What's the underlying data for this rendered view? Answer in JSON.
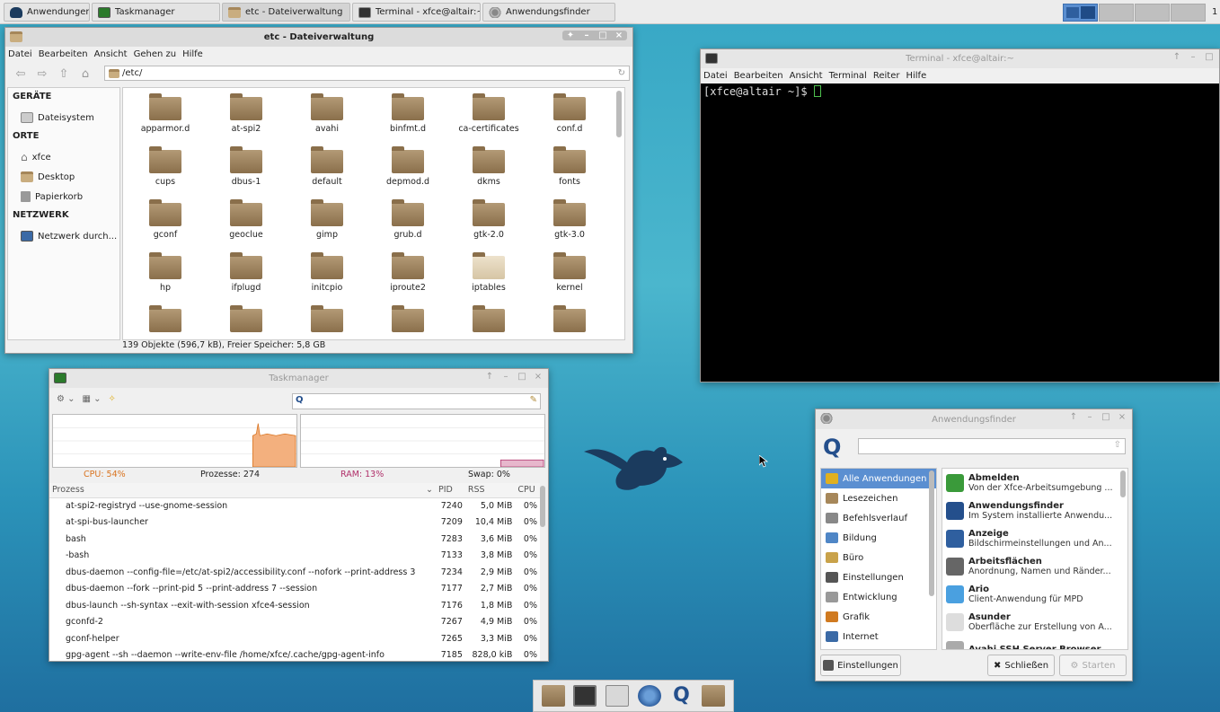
{
  "top_panel": {
    "tasks": [
      {
        "label": "Anwendungen",
        "icon": "xfce-mouse-icon"
      },
      {
        "label": "Taskmanager",
        "icon": "task-manager-icon"
      },
      {
        "label": "etc - Dateiverwaltung",
        "icon": "folder-icon"
      },
      {
        "label": "Terminal - xfce@altair:~",
        "icon": "terminal-icon"
      },
      {
        "label": "Anwendungsfinder",
        "icon": "app-finder-icon"
      }
    ],
    "clock": "1"
  },
  "file_manager": {
    "title": "etc - Dateiverwaltung",
    "menu": [
      "Datei",
      "Bearbeiten",
      "Ansicht",
      "Gehen zu",
      "Hilfe"
    ],
    "path": "/etc/",
    "sidebar": {
      "geraete_header": "GERÄTE",
      "dateisystem": "Dateisystem",
      "orte_header": "ORTE",
      "xfce": "xfce",
      "desktop": "Desktop",
      "papierkorb": "Papierkorb",
      "netzwerk_header": "NETZWERK",
      "netzwerk_item": "Netzwerk durch..."
    },
    "folders": [
      "apparmor.d",
      "at-spi2",
      "avahi",
      "binfmt.d",
      "ca-certificates",
      "conf.d",
      "cups",
      "dbus-1",
      "default",
      "depmod.d",
      "dkms",
      "fonts",
      "gconf",
      "geoclue",
      "gimp",
      "grub.d",
      "gtk-2.0",
      "gtk-3.0",
      "hp",
      "ifplugd",
      "initcpio",
      "iproute2",
      "iptables",
      "kernel"
    ],
    "status": "139 Objekte (596,7 kB), Freier Speicher: 5,8 GB"
  },
  "terminal": {
    "title": "Terminal - xfce@altair:~",
    "menu": [
      "Datei",
      "Bearbeiten",
      "Ansicht",
      "Terminal",
      "Reiter",
      "Hilfe"
    ],
    "prompt": "[xfce@altair ~]$ "
  },
  "task_manager": {
    "title": "Taskmanager",
    "cpu": "CPU: 54%",
    "processes": "Prozesse: 274",
    "ram": "RAM: 13%",
    "swap": "Swap: 0%",
    "columns": {
      "name": "Prozess",
      "pid": "PID",
      "rss": "RSS",
      "cpu": "CPU"
    },
    "rows": [
      {
        "name": "at-spi2-registryd --use-gnome-session",
        "pid": "7240",
        "rss": "5,0 MiB",
        "cpu": "0%"
      },
      {
        "name": "at-spi-bus-launcher",
        "pid": "7209",
        "rss": "10,4 MiB",
        "cpu": "0%"
      },
      {
        "name": "bash",
        "pid": "7283",
        "rss": "3,6 MiB",
        "cpu": "0%"
      },
      {
        "name": "-bash",
        "pid": "7133",
        "rss": "3,8 MiB",
        "cpu": "0%"
      },
      {
        "name": "dbus-daemon --config-file=/etc/at-spi2/accessibility.conf --nofork --print-address 3",
        "pid": "7234",
        "rss": "2,9 MiB",
        "cpu": "0%"
      },
      {
        "name": "dbus-daemon --fork --print-pid 5 --print-address 7 --session",
        "pid": "7177",
        "rss": "2,7 MiB",
        "cpu": "0%"
      },
      {
        "name": "dbus-launch --sh-syntax --exit-with-session xfce4-session",
        "pid": "7176",
        "rss": "1,8 MiB",
        "cpu": "0%"
      },
      {
        "name": "gconfd-2",
        "pid": "7267",
        "rss": "4,9 MiB",
        "cpu": "0%"
      },
      {
        "name": "gconf-helper",
        "pid": "7265",
        "rss": "3,3 MiB",
        "cpu": "0%"
      },
      {
        "name": "gpg-agent --sh --daemon --write-env-file /home/xfce/.cache/gpg-agent-info",
        "pid": "7185",
        "rss": "828,0 kiB",
        "cpu": "0%"
      }
    ]
  },
  "app_finder": {
    "title": "Anwendungsfinder",
    "categories": [
      "Alle Anwendungen",
      "Lesezeichen",
      "Befehlsverlauf",
      "Bildung",
      "Büro",
      "Einstellungen",
      "Entwicklung",
      "Grafik",
      "Internet"
    ],
    "apps": [
      {
        "name": "Abmelden",
        "desc": "Von der Xfce-Arbeitsumgebung ..."
      },
      {
        "name": "Anwendungsfinder",
        "desc": "Im System installierte Anwendu..."
      },
      {
        "name": "Anzeige",
        "desc": "Bildschirmeinstellungen und An..."
      },
      {
        "name": "Arbeitsflächen",
        "desc": "Anordnung, Namen und Ränder..."
      },
      {
        "name": "Ario",
        "desc": "Client-Anwendung für MPD"
      },
      {
        "name": "Asunder",
        "desc": "Oberfläche zur Erstellung von A..."
      },
      {
        "name": "Avahi SSH Server Browser",
        "desc": ""
      }
    ],
    "settings_button": "Einstellungen",
    "close_button": "Schließen",
    "start_button": "Starten"
  },
  "colors": {
    "selection": "#5b8fd1",
    "cpu_graph": "#f3b07e",
    "ram_graph": "#b0306a",
    "cpu_text": "#d9731f",
    "ram_text": "#b0306a"
  }
}
